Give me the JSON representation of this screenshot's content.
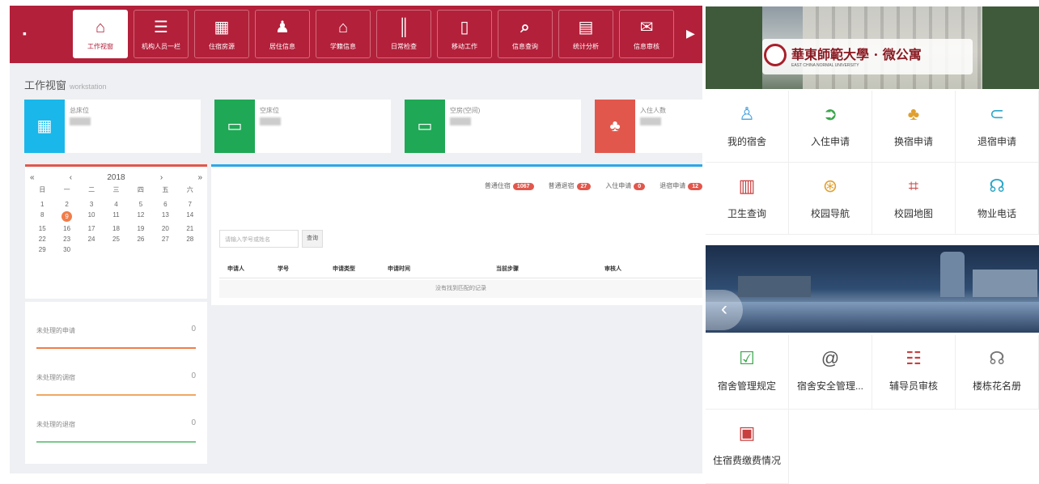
{
  "admin": {
    "nav": [
      {
        "label": "工作视窗",
        "icon": "home-icon",
        "glyph": "⌂"
      },
      {
        "label": "机构人员一栏",
        "icon": "list-icon",
        "glyph": "☰"
      },
      {
        "label": "住宿房源",
        "icon": "grid-icon",
        "glyph": "▦"
      },
      {
        "label": "居住信息",
        "icon": "user-icon",
        "glyph": "♟"
      },
      {
        "label": "学籍信息",
        "icon": "graduation-cap-icon",
        "glyph": "⌂"
      },
      {
        "label": "日常检查",
        "icon": "barcode-icon",
        "glyph": "║"
      },
      {
        "label": "移动工作",
        "icon": "phone-icon",
        "glyph": "▯"
      },
      {
        "label": "信息查询",
        "icon": "search-icon",
        "glyph": "⌕"
      },
      {
        "label": "统计分析",
        "icon": "table-icon",
        "glyph": "▤"
      },
      {
        "label": "信息审核",
        "icon": "mail-icon",
        "glyph": "✉"
      }
    ],
    "workspace_title": "工作视窗",
    "workspace_sub": "workstation",
    "cards": [
      {
        "title": "总床位",
        "color": "#1ab7ea",
        "icon": "apps-icon",
        "glyph": "▦"
      },
      {
        "title": "空床位",
        "color": "#1fa855",
        "icon": "monitor-icon",
        "glyph": "▭"
      },
      {
        "title": "空房(空间)",
        "color": "#1fa855",
        "icon": "monitor-icon",
        "glyph": "▭"
      },
      {
        "title": "入住人数",
        "color": "#e2574c",
        "icon": "people-icon",
        "glyph": "♣"
      }
    ],
    "calendar": {
      "year": "2018",
      "weekdays": [
        "日",
        "一",
        "二",
        "三",
        "四",
        "五",
        "六"
      ],
      "days": [
        "",
        "",
        "",
        "",
        "",
        "",
        "",
        "1",
        "2",
        "3",
        "4",
        "5",
        "6",
        "7",
        "8",
        "9",
        "10",
        "11",
        "12",
        "13",
        "14",
        "15",
        "16",
        "17",
        "18",
        "19",
        "20",
        "21",
        "22",
        "23",
        "24",
        "25",
        "26",
        "27",
        "28",
        "29",
        "30"
      ],
      "today": "9"
    },
    "stats": [
      {
        "label": "未处理的申请",
        "value": "0",
        "color": "#f07d4a"
      },
      {
        "label": "未处理的调宿",
        "value": "0",
        "color": "#f0a860"
      },
      {
        "label": "未处理的退宿",
        "value": "0",
        "color": "#7cc98d"
      }
    ],
    "badges": [
      {
        "label": "普通住宿",
        "count": "1067"
      },
      {
        "label": "普通退宿",
        "count": "27"
      },
      {
        "label": "入住申请",
        "count": "0"
      },
      {
        "label": "退宿申请",
        "count": "12"
      }
    ],
    "search_placeholder": "请输入学号或姓名",
    "query_label": "查询",
    "table_headers": [
      "申请人",
      "学号",
      "申请类型",
      "申请时间",
      "当前步骤",
      "审核人"
    ],
    "empty_text": "没有找到匹配的记录"
  },
  "mobile": {
    "school_name": "華東師範大學 · 微公寓",
    "school_en": "EAST CHINA NORMAL UNIVERSITY",
    "grid1": [
      {
        "label": "我的宿舍",
        "icon": "person-icon",
        "glyph": "♙",
        "color": "#4aa3e0"
      },
      {
        "label": "入住申请",
        "icon": "arrow-right-circle-icon",
        "glyph": "➲",
        "color": "#3aa64a"
      },
      {
        "label": "换宿申请",
        "icon": "people-icon",
        "glyph": "♣",
        "color": "#e0a030"
      },
      {
        "label": "退宿申请",
        "icon": "arrow-left-circle-icon",
        "glyph": "⊂",
        "color": "#2aa8c8"
      },
      {
        "label": "卫生查询",
        "icon": "building-icon",
        "glyph": "▥",
        "color": "#c84040"
      },
      {
        "label": "校园导航",
        "icon": "compass-icon",
        "glyph": "⊛",
        "color": "#e0a030"
      },
      {
        "label": "校园地图",
        "icon": "scan-icon",
        "glyph": "⌗",
        "color": "#c84040"
      },
      {
        "label": "物业电话",
        "icon": "headset-icon",
        "glyph": "☊",
        "color": "#2aa8c8"
      }
    ],
    "grid2": [
      {
        "label": "宿舍管理规定",
        "icon": "checklist-icon",
        "glyph": "☑",
        "color": "#3aa64a"
      },
      {
        "label": "宿舍安全管理...",
        "icon": "at-icon",
        "glyph": "@",
        "color": "#555555"
      },
      {
        "label": "辅导员审核",
        "icon": "document-icon",
        "glyph": "☷",
        "color": "#c84040"
      },
      {
        "label": "楼栋花名册",
        "icon": "headset-icon",
        "glyph": "☊",
        "color": "#777777"
      },
      {
        "label": "住宿费缴费情况",
        "icon": "easel-icon",
        "glyph": "▣",
        "color": "#c84040"
      }
    ]
  }
}
